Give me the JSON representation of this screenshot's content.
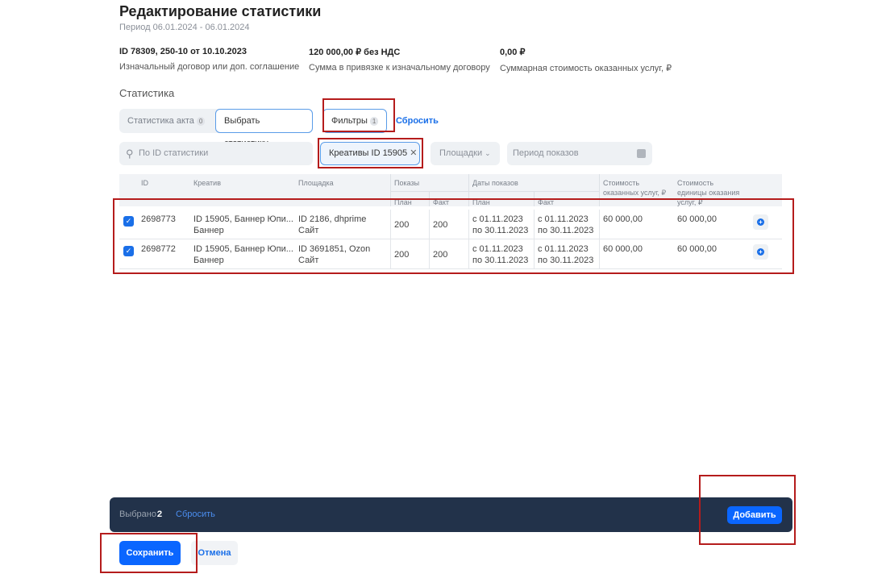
{
  "header": {
    "title": "Редактирование статистики",
    "period": "Период 06.01.2024 - 06.01.2024"
  },
  "info": [
    {
      "value": "ID 78309, 250-10 от 10.10.2023",
      "label": "Изначальный договор или доп. соглашение"
    },
    {
      "value": "120 000,00 ₽ без НДС",
      "label": "Сумма в привязке к изначальному договору"
    },
    {
      "value": "0,00 ₽",
      "label": "Суммарная стоимость оказанных услуг, ₽"
    }
  ],
  "section": "Статистика",
  "tabs": [
    {
      "label": "Статистика акта",
      "count": "0"
    },
    {
      "label": "Выбрать статистику"
    }
  ],
  "filters_button": {
    "label": "Фильтры",
    "count": "1"
  },
  "reset_link": "Сбросить",
  "search": {
    "placeholder": "По ID статистики"
  },
  "chip": "Креативы ID 15905",
  "platforms": "Площадки",
  "period_input": {
    "placeholder": "Период показов"
  },
  "table": {
    "headers": {
      "id": "ID",
      "creative": "Креатив",
      "platform": "Площадка",
      "shows": "Показы",
      "dates": "Даты показов",
      "plan": "План",
      "fact": "Факт",
      "cost": "Стоимость оказанных услуг, ₽",
      "unit_cost": "Стоимость единицы оказания услуг, ₽"
    },
    "rows": [
      {
        "checked": true,
        "id": "2698773",
        "creative1": "ID 15905, Баннер Юпи...",
        "creative2": "Баннер",
        "platform1": "ID 2186, dhprime",
        "platform2": "Сайт",
        "plan": "200",
        "fact": "200",
        "date_plan1": "с 01.11.2023",
        "date_plan2": "по 30.11.2023",
        "date_fact1": "с 01.11.2023",
        "date_fact2": "по 30.11.2023",
        "cost": "60 000,00",
        "unit_cost": "60 000,00"
      },
      {
        "checked": true,
        "id": "2698772",
        "creative1": "ID 15905, Баннер Юпи...",
        "creative2": "Баннер",
        "platform1": "ID 3691851, Ozon",
        "platform2": "Сайт",
        "plan": "200",
        "fact": "200",
        "date_plan1": "с 01.11.2023",
        "date_plan2": "по 30.11.2023",
        "date_fact1": "с 01.11.2023",
        "date_fact2": "по 30.11.2023",
        "cost": "60 000,00",
        "unit_cost": "60 000,00"
      }
    ]
  },
  "selection_bar": {
    "selected_label": "Выбрано:",
    "selected_count": "2",
    "reset": "Сбросить",
    "add": "Добавить"
  },
  "footer": {
    "save": "Сохранить",
    "cancel": "Отмена"
  },
  "colors": {
    "accent": "#0a66ff",
    "bar": "#22324a",
    "annotation": "#b51c1c"
  }
}
